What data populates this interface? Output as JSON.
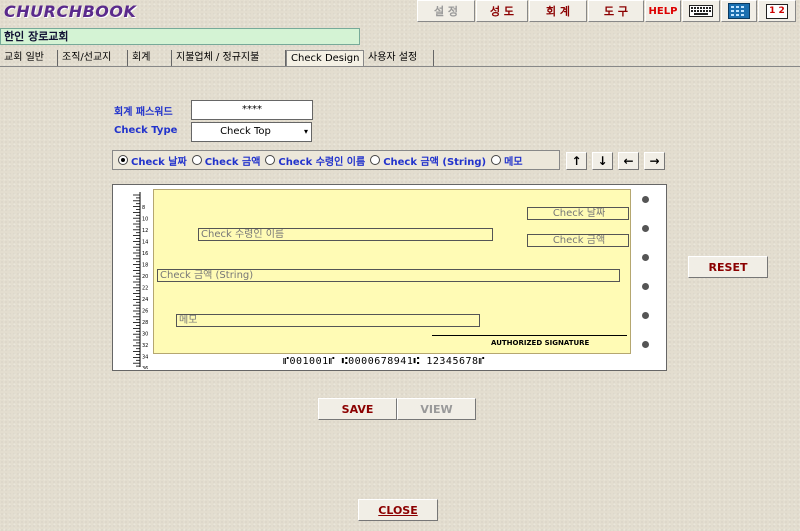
{
  "app": {
    "title": "CHURCHBOOK"
  },
  "top_menu": {
    "settings": "설 정",
    "members": "성 도",
    "accounting": "회 계",
    "tools": "도 구",
    "help": "HELP",
    "calculator": "1 2"
  },
  "church_name": "한인 장로교회",
  "tabs": [
    "교회 일반",
    "조직/선교지",
    "회계",
    "지불업체 / 정규지불",
    "Check Design",
    "사용자 설정"
  ],
  "form": {
    "password_label": "회계 패스워드",
    "password_value": "****",
    "check_type_label": "Check Type",
    "check_type_value": "Check Top"
  },
  "radio_options": [
    "Check 날짜",
    "Check 금액",
    "Check 수령인 이름",
    "Check 금액 (String)",
    "메모"
  ],
  "radio_selected": "Check 날짜",
  "arrows": {
    "up": "↑",
    "down": "↓",
    "left": "←",
    "right": "→"
  },
  "check": {
    "date_field": "Check 날짜",
    "payee_field": "Check 수령인 이름",
    "amount_field": "Check 금액",
    "amount_string_field": "Check 금액 (String)",
    "memo_field": "메모",
    "signature_label": "AUTHORIZED SIGNATURE",
    "micr_line": "⑈001001⑈ ⑆0000678941⑆ 12345678⑈"
  },
  "ruler_numbers": [
    "8",
    "10",
    "12",
    "14",
    "16",
    "18",
    "20",
    "22",
    "24",
    "26",
    "28",
    "30",
    "32",
    "34",
    "36"
  ],
  "buttons": {
    "reset": "RESET",
    "save": "SAVE",
    "view": "VIEW",
    "close": "CLOSE"
  }
}
